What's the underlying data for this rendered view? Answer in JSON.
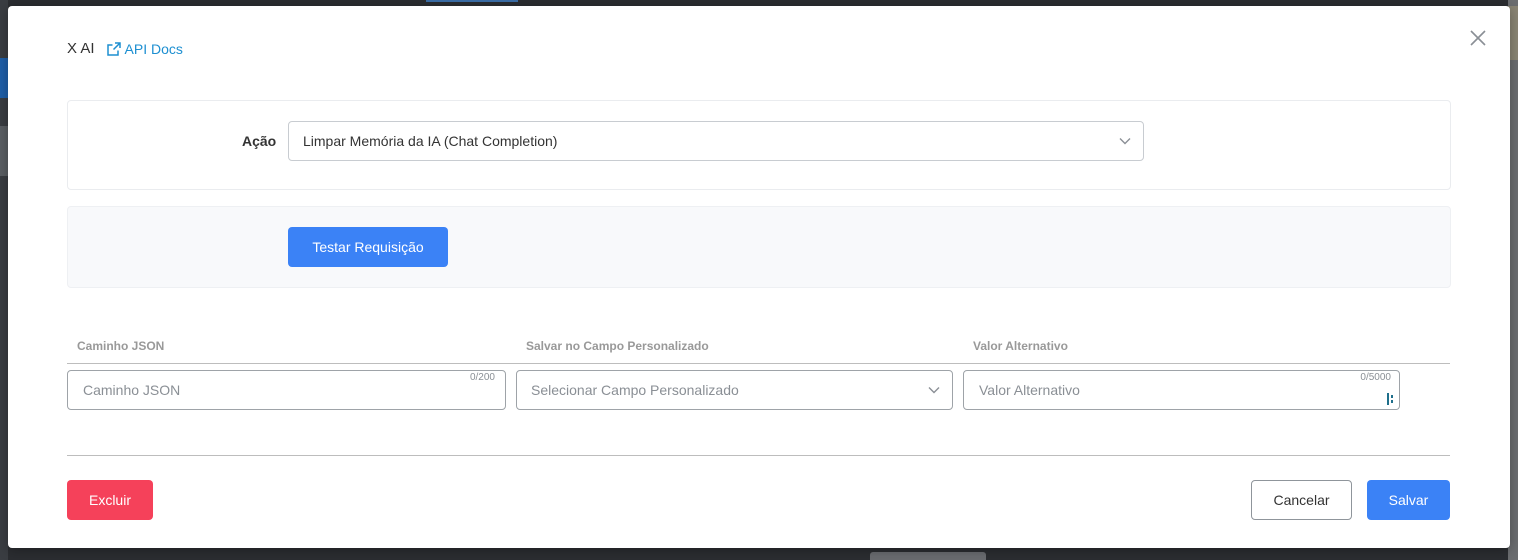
{
  "modal": {
    "title": "X AI",
    "docs_link": "API Docs"
  },
  "action": {
    "label": "Ação",
    "selected": "Limpar Memória da IA (Chat Completion)"
  },
  "test": {
    "button_label": "Testar Requisição"
  },
  "mapping": {
    "headers": [
      "Caminho JSON",
      "Salvar no Campo Personalizado",
      "Valor Alternativo"
    ],
    "json_path": {
      "placeholder": "Caminho JSON",
      "value": "",
      "counter": "0/200"
    },
    "custom_field": {
      "placeholder": "Selecionar Campo Personalizado"
    },
    "fallback": {
      "placeholder": "Valor Alternativo",
      "value": "",
      "counter": "0/5000"
    }
  },
  "footer": {
    "delete_label": "Excluir",
    "cancel_label": "Cancelar",
    "save_label": "Salvar"
  },
  "colors": {
    "primary": "#3b82f6",
    "danger": "#f5415a",
    "link": "#1d8fd1"
  },
  "icons": {
    "docs": "external-link-icon",
    "close": "close-icon",
    "select": "chevron-down-icon"
  }
}
